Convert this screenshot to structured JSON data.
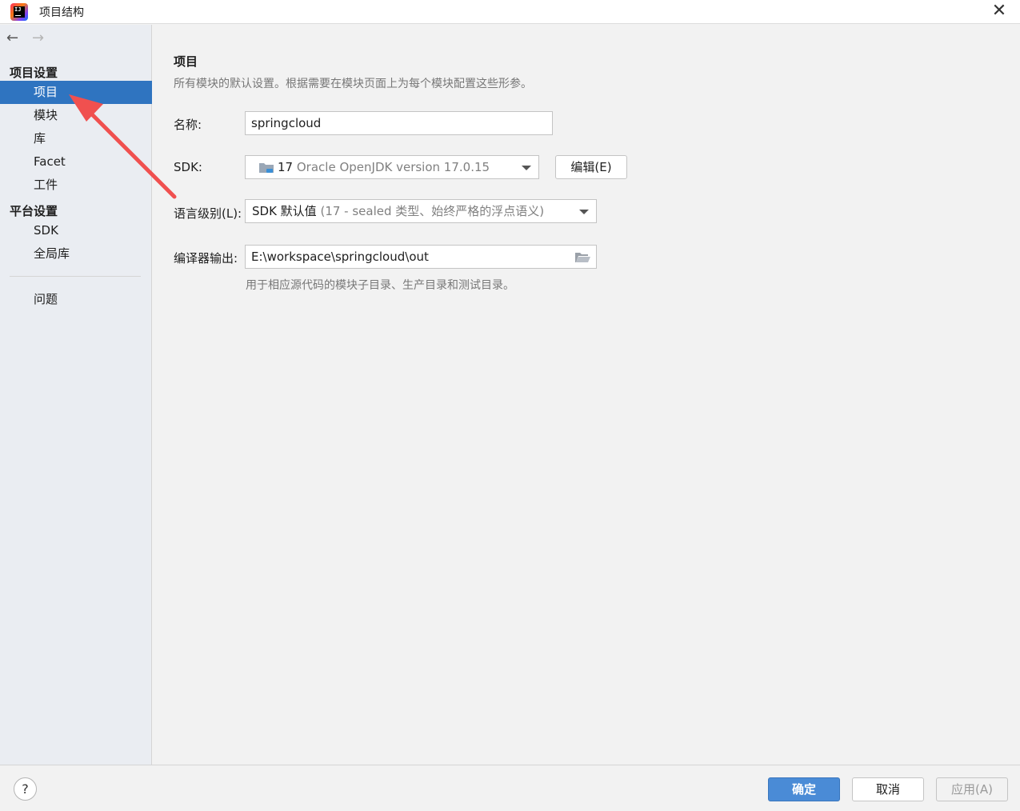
{
  "window": {
    "title": "项目结构",
    "close_glyph": "✕"
  },
  "sidebar": {
    "back_glyph": "←",
    "forward_glyph": "→",
    "project_settings_header": "项目设置",
    "project_items": [
      {
        "label": "项目",
        "selected": true
      },
      {
        "label": "模块",
        "selected": false
      },
      {
        "label": "库",
        "selected": false
      },
      {
        "label": "Facet",
        "selected": false
      },
      {
        "label": "工件",
        "selected": false
      }
    ],
    "platform_settings_header": "平台设置",
    "platform_items": [
      {
        "label": "SDK"
      },
      {
        "label": "全局库"
      }
    ],
    "problems_label": "问题"
  },
  "main": {
    "heading": "项目",
    "description": "所有模块的默认设置。根据需要在模块页面上为每个模块配置这些形参。",
    "name_label": "名称:",
    "name_value": "springcloud",
    "sdk_label": "SDK:",
    "sdk_version": "17",
    "sdk_name": "Oracle OpenJDK version 17.0.15",
    "edit_button": "编辑(E)",
    "language_level_label": "语言级别(L):",
    "language_level_value": "SDK 默认值",
    "language_level_detail": "(17 - sealed 类型、始终严格的浮点语义)",
    "compiler_output_label": "编译器输出:",
    "compiler_output_value": "E:\\workspace\\springcloud\\out",
    "compiler_output_hint": "用于相应源代码的模块子目录、生产目录和测试目录。"
  },
  "footer": {
    "help_glyph": "?",
    "ok_button": "确定",
    "cancel_button": "取消",
    "apply_button": "应用(A)"
  },
  "colors": {
    "selection": "#2f74c0",
    "primary_button": "#4a8bd6",
    "annotation_arrow": "#f0504f"
  },
  "icons": {
    "app": "intellij-idea-icon",
    "sdk": "sdk-folder-icon",
    "browse": "folder-open-icon",
    "close": "close-icon"
  }
}
